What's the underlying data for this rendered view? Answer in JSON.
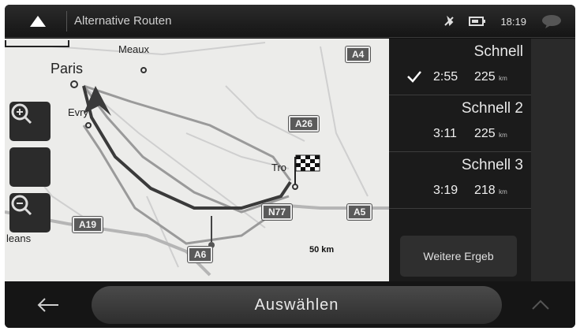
{
  "header": {
    "title": "Alternative Routen",
    "clock": "18:19"
  },
  "map": {
    "labels": {
      "paris": "Paris",
      "meaux": "Meaux",
      "evry": "Evry",
      "troyes": "Tro",
      "orleans": "leans"
    },
    "roads": {
      "a4": "A4",
      "a26": "A26",
      "n77": "N77",
      "a5": "A5",
      "a19": "A19",
      "a6": "A6"
    },
    "scale": "50 km"
  },
  "routes": [
    {
      "name": "Schnell",
      "time": "2:55",
      "distance": "225",
      "unit": "km",
      "selected": true
    },
    {
      "name": "Schnell 2",
      "time": "3:11",
      "distance": "225",
      "unit": "km",
      "selected": false
    },
    {
      "name": "Schnell 3",
      "time": "3:19",
      "distance": "218",
      "unit": "km",
      "selected": false
    }
  ],
  "more_button": "Weitere Ergeb",
  "bottom": {
    "select_label": "Auswählen"
  },
  "colors": {
    "route_primary": "#4a4a4a",
    "route_alt": "#8a8a8a",
    "map_bg": "#ececea"
  }
}
